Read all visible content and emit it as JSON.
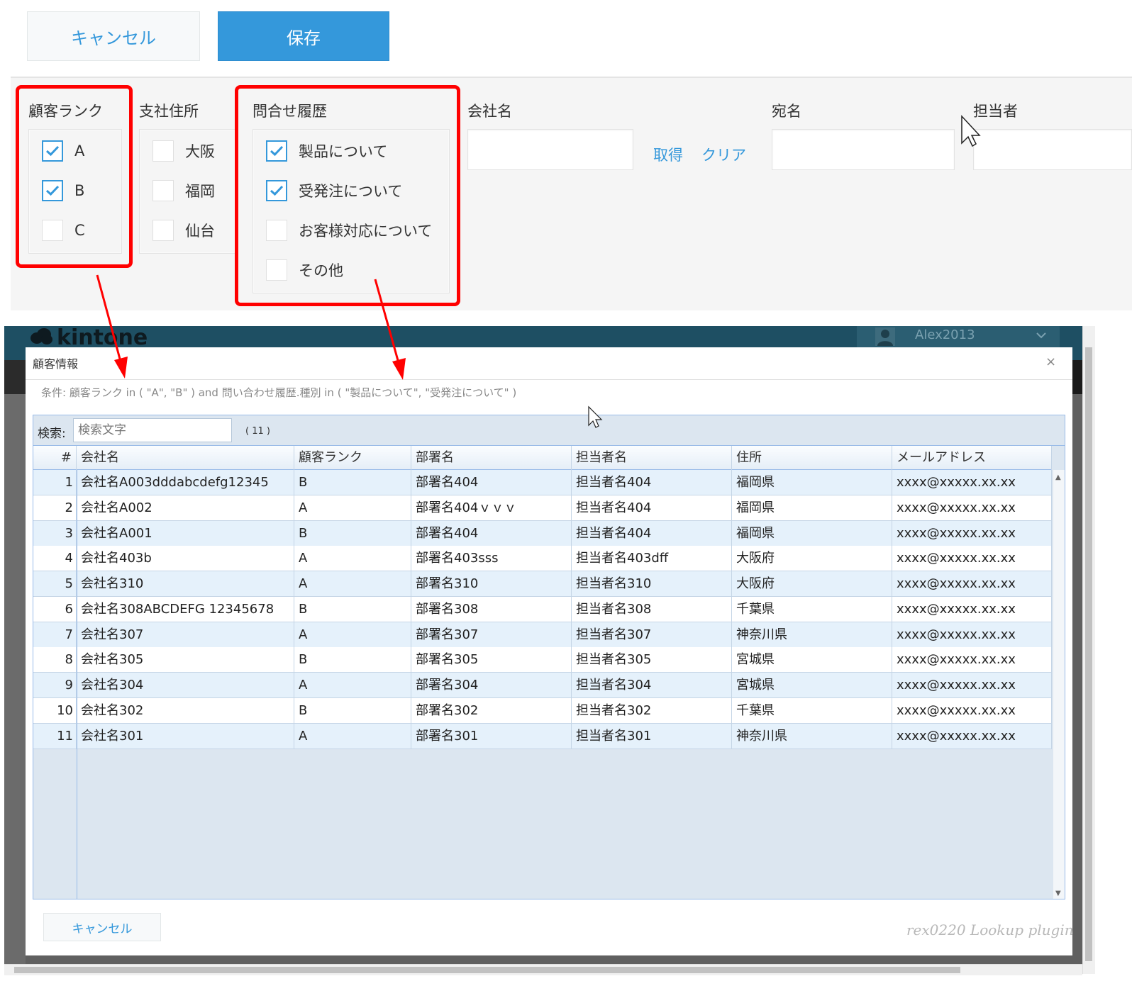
{
  "toolbar": {
    "cancel_label": "キャンセル",
    "save_label": "保存"
  },
  "form": {
    "customer_rank": {
      "label": "顧客ランク",
      "options": [
        {
          "label": "A",
          "checked": true
        },
        {
          "label": "B",
          "checked": true
        },
        {
          "label": "C",
          "checked": false
        }
      ]
    },
    "branch_address": {
      "label": "支社住所",
      "options": [
        {
          "label": "大阪",
          "checked": false
        },
        {
          "label": "福岡",
          "checked": false
        },
        {
          "label": "仙台",
          "checked": false
        }
      ]
    },
    "inquiry_history": {
      "label": "問合せ履歴",
      "options": [
        {
          "label": "製品について",
          "checked": true
        },
        {
          "label": "受発注について",
          "checked": true
        },
        {
          "label": "お客様対応について",
          "checked": false
        },
        {
          "label": "その他",
          "checked": false
        }
      ]
    },
    "company_name": {
      "label": "会社名",
      "value": ""
    },
    "fetch_link": "取得",
    "clear_link": "クリア",
    "addressee": {
      "label": "宛名",
      "value": ""
    },
    "person_in_charge": {
      "label": "担当者",
      "value": ""
    }
  },
  "app": {
    "logo": "kintone",
    "user": "Alex2013"
  },
  "modal": {
    "title": "顧客情報",
    "close": "×",
    "condition": "条件: 顧客ランク in ( \"A\", \"B\" ) and 問い合わせ履歴.種別 in ( \"製品について\", \"受発注について\" )",
    "search_label": "検索:",
    "search_placeholder": "検索文字",
    "result_count": "( 11 )",
    "columns": [
      "#",
      "会社名",
      "顧客ランク",
      "部署名",
      "担当者名",
      "住所",
      "メールアドレス"
    ],
    "rows": [
      [
        "1",
        "会社名A003dddabcdefg12345",
        "B",
        "部署名404",
        "担当者名404",
        "福岡県",
        "xxxx@xxxxx.xx.xx"
      ],
      [
        "2",
        "会社名A002",
        "A",
        "部署名404ｖｖｖ",
        "担当者名404",
        "福岡県",
        "xxxx@xxxxx.xx.xx"
      ],
      [
        "3",
        "会社名A001",
        "B",
        "部署名404",
        "担当者名404",
        "福岡県",
        "xxxx@xxxxx.xx.xx"
      ],
      [
        "4",
        "会社名403b",
        "A",
        "部署名403sss",
        "担当者名403dff",
        "大阪府",
        "xxxx@xxxxx.xx.xx"
      ],
      [
        "5",
        "会社名310",
        "A",
        "部署名310",
        "担当者名310",
        "大阪府",
        "xxxx@xxxxx.xx.xx"
      ],
      [
        "6",
        "会社名308ABCDEFG 12345678",
        "B",
        "部署名308",
        "担当者名308",
        "千葉県",
        "xxxx@xxxxx.xx.xx"
      ],
      [
        "7",
        "会社名307",
        "A",
        "部署名307",
        "担当者名307",
        "神奈川県",
        "xxxx@xxxxx.xx.xx"
      ],
      [
        "8",
        "会社名305",
        "B",
        "部署名305",
        "担当者名305",
        "宮城県",
        "xxxx@xxxxx.xx.xx"
      ],
      [
        "9",
        "会社名304",
        "A",
        "部署名304",
        "担当者名304",
        "宮城県",
        "xxxx@xxxxx.xx.xx"
      ],
      [
        "10",
        "会社名302",
        "B",
        "部署名302",
        "担当者名302",
        "千葉県",
        "xxxx@xxxxx.xx.xx"
      ],
      [
        "11",
        "会社名301",
        "A",
        "部署名301",
        "担当者名301",
        "神奈川県",
        "xxxx@xxxxx.xx.xx"
      ]
    ],
    "cancel_label": "キャンセル",
    "plugin_credit": "rex0220 Lookup plugin"
  },
  "colors": {
    "accent": "#3498db",
    "highlight": "#ff0000",
    "grid_border": "#99bbe8",
    "row_alt": "#e5f1fb"
  }
}
